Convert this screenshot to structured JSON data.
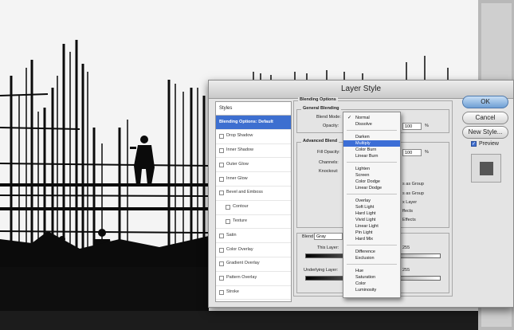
{
  "dialog": {
    "title": "Layer Style",
    "styles_header": "Styles",
    "style_items": [
      {
        "label": "Blending Options: Default",
        "selected": true,
        "checkbox": false,
        "sub": false
      },
      {
        "label": "Drop Shadow",
        "selected": false,
        "checkbox": true,
        "sub": false
      },
      {
        "label": "Inner Shadow",
        "selected": false,
        "checkbox": true,
        "sub": false
      },
      {
        "label": "Outer Glow",
        "selected": false,
        "checkbox": true,
        "sub": false
      },
      {
        "label": "Inner Glow",
        "selected": false,
        "checkbox": true,
        "sub": false
      },
      {
        "label": "Bevel and Emboss",
        "selected": false,
        "checkbox": true,
        "sub": false
      },
      {
        "label": "Contour",
        "selected": false,
        "checkbox": true,
        "sub": true
      },
      {
        "label": "Texture",
        "selected": false,
        "checkbox": true,
        "sub": true
      },
      {
        "label": "Satin",
        "selected": false,
        "checkbox": true,
        "sub": false
      },
      {
        "label": "Color Overlay",
        "selected": false,
        "checkbox": true,
        "sub": false
      },
      {
        "label": "Gradient Overlay",
        "selected": false,
        "checkbox": true,
        "sub": false
      },
      {
        "label": "Pattern Overlay",
        "selected": false,
        "checkbox": true,
        "sub": false
      },
      {
        "label": "Stroke",
        "selected": false,
        "checkbox": true,
        "sub": false
      }
    ],
    "blending_options_title": "Blending Options",
    "general_blending_title": "General Blending",
    "blend_mode_label": "Blend Mode:",
    "opacity_label": "Opacity:",
    "opacity_value": "100",
    "opacity_unit": "%",
    "advanced_blending_title": "Advanced Blend",
    "fill_opacity_label": "Fill Opacity:",
    "fill_opacity_value": "100",
    "fill_opacity_unit": "%",
    "channels_label": "Channels:",
    "knockout_label": "Knockout:",
    "partial_options": [
      "s as Group",
      "s as Group",
      "x Layer",
      "ffects",
      "Effects"
    ],
    "blend_if_label": "Blend If:",
    "blend_if_value": "Gray",
    "this_layer_label": "This Layer:",
    "this_layer_partial": "255",
    "underlying_layer_label": "Underlying Layer:",
    "underlying_layer_partial": "255",
    "ok_label": "OK",
    "cancel_label": "Cancel",
    "new_style_label": "New Style...",
    "preview_label": "Preview"
  },
  "blend_menu": {
    "groups": [
      [
        "Normal",
        "Dissolve"
      ],
      [
        "Darken",
        "Multiply",
        "Color Burn",
        "Linear Burn"
      ],
      [
        "Lighten",
        "Screen",
        "Color Dodge",
        "Linear Dodge"
      ],
      [
        "Overlay",
        "Soft Light",
        "Hard Light",
        "Vivid Light",
        "Linear Light",
        "Pin Light",
        "Hard Mix"
      ],
      [
        "Difference",
        "Exclusion"
      ],
      [
        "Hue",
        "Saturation",
        "Color",
        "Luminosity"
      ]
    ],
    "checked": "Normal",
    "highlighted": "Multiply",
    "check_glyph": "✓"
  },
  "colors": {
    "selection": "#3c6ed6",
    "dialog_bg": "#e4e4e4",
    "silhouette": "#0b0b0b"
  }
}
